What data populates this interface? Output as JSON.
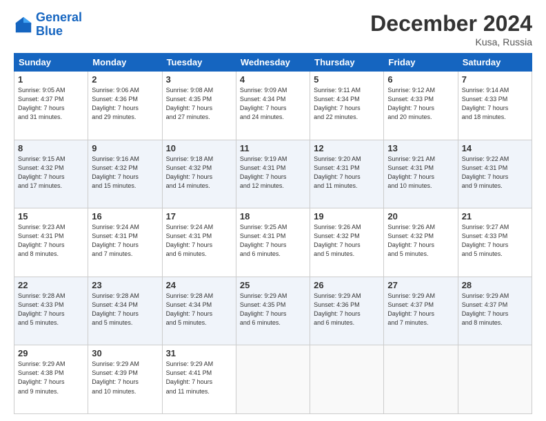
{
  "header": {
    "logo_text_general": "General",
    "logo_text_blue": "Blue",
    "month_title": "December 2024",
    "location": "Kusa, Russia"
  },
  "days_of_week": [
    "Sunday",
    "Monday",
    "Tuesday",
    "Wednesday",
    "Thursday",
    "Friday",
    "Saturday"
  ],
  "weeks": [
    [
      {
        "day": "1",
        "sunrise": "9:05 AM",
        "sunset": "4:37 PM",
        "daylight": "7 hours and 31 minutes."
      },
      {
        "day": "2",
        "sunrise": "9:06 AM",
        "sunset": "4:36 PM",
        "daylight": "7 hours and 29 minutes."
      },
      {
        "day": "3",
        "sunrise": "9:08 AM",
        "sunset": "4:35 PM",
        "daylight": "7 hours and 27 minutes."
      },
      {
        "day": "4",
        "sunrise": "9:09 AM",
        "sunset": "4:34 PM",
        "daylight": "7 hours and 24 minutes."
      },
      {
        "day": "5",
        "sunrise": "9:11 AM",
        "sunset": "4:34 PM",
        "daylight": "7 hours and 22 minutes."
      },
      {
        "day": "6",
        "sunrise": "9:12 AM",
        "sunset": "4:33 PM",
        "daylight": "7 hours and 20 minutes."
      },
      {
        "day": "7",
        "sunrise": "9:14 AM",
        "sunset": "4:33 PM",
        "daylight": "7 hours and 18 minutes."
      }
    ],
    [
      {
        "day": "8",
        "sunrise": "9:15 AM",
        "sunset": "4:32 PM",
        "daylight": "7 hours and 17 minutes."
      },
      {
        "day": "9",
        "sunrise": "9:16 AM",
        "sunset": "4:32 PM",
        "daylight": "7 hours and 15 minutes."
      },
      {
        "day": "10",
        "sunrise": "9:18 AM",
        "sunset": "4:32 PM",
        "daylight": "7 hours and 14 minutes."
      },
      {
        "day": "11",
        "sunrise": "9:19 AM",
        "sunset": "4:31 PM",
        "daylight": "7 hours and 12 minutes."
      },
      {
        "day": "12",
        "sunrise": "9:20 AM",
        "sunset": "4:31 PM",
        "daylight": "7 hours and 11 minutes."
      },
      {
        "day": "13",
        "sunrise": "9:21 AM",
        "sunset": "4:31 PM",
        "daylight": "7 hours and 10 minutes."
      },
      {
        "day": "14",
        "sunrise": "9:22 AM",
        "sunset": "4:31 PM",
        "daylight": "7 hours and 9 minutes."
      }
    ],
    [
      {
        "day": "15",
        "sunrise": "9:23 AM",
        "sunset": "4:31 PM",
        "daylight": "7 hours and 8 minutes."
      },
      {
        "day": "16",
        "sunrise": "9:24 AM",
        "sunset": "4:31 PM",
        "daylight": "7 hours and 7 minutes."
      },
      {
        "day": "17",
        "sunrise": "9:24 AM",
        "sunset": "4:31 PM",
        "daylight": "7 hours and 6 minutes."
      },
      {
        "day": "18",
        "sunrise": "9:25 AM",
        "sunset": "4:31 PM",
        "daylight": "7 hours and 6 minutes."
      },
      {
        "day": "19",
        "sunrise": "9:26 AM",
        "sunset": "4:32 PM",
        "daylight": "7 hours and 5 minutes."
      },
      {
        "day": "20",
        "sunrise": "9:26 AM",
        "sunset": "4:32 PM",
        "daylight": "7 hours and 5 minutes."
      },
      {
        "day": "21",
        "sunrise": "9:27 AM",
        "sunset": "4:33 PM",
        "daylight": "7 hours and 5 minutes."
      }
    ],
    [
      {
        "day": "22",
        "sunrise": "9:28 AM",
        "sunset": "4:33 PM",
        "daylight": "7 hours and 5 minutes."
      },
      {
        "day": "23",
        "sunrise": "9:28 AM",
        "sunset": "4:34 PM",
        "daylight": "7 hours and 5 minutes."
      },
      {
        "day": "24",
        "sunrise": "9:28 AM",
        "sunset": "4:34 PM",
        "daylight": "7 hours and 5 minutes."
      },
      {
        "day": "25",
        "sunrise": "9:29 AM",
        "sunset": "4:35 PM",
        "daylight": "7 hours and 6 minutes."
      },
      {
        "day": "26",
        "sunrise": "9:29 AM",
        "sunset": "4:36 PM",
        "daylight": "7 hours and 6 minutes."
      },
      {
        "day": "27",
        "sunrise": "9:29 AM",
        "sunset": "4:37 PM",
        "daylight": "7 hours and 7 minutes."
      },
      {
        "day": "28",
        "sunrise": "9:29 AM",
        "sunset": "4:37 PM",
        "daylight": "7 hours and 8 minutes."
      }
    ],
    [
      {
        "day": "29",
        "sunrise": "9:29 AM",
        "sunset": "4:38 PM",
        "daylight": "7 hours and 9 minutes."
      },
      {
        "day": "30",
        "sunrise": "9:29 AM",
        "sunset": "4:39 PM",
        "daylight": "7 hours and 10 minutes."
      },
      {
        "day": "31",
        "sunrise": "9:29 AM",
        "sunset": "4:41 PM",
        "daylight": "7 hours and 11 minutes."
      },
      null,
      null,
      null,
      null
    ]
  ]
}
